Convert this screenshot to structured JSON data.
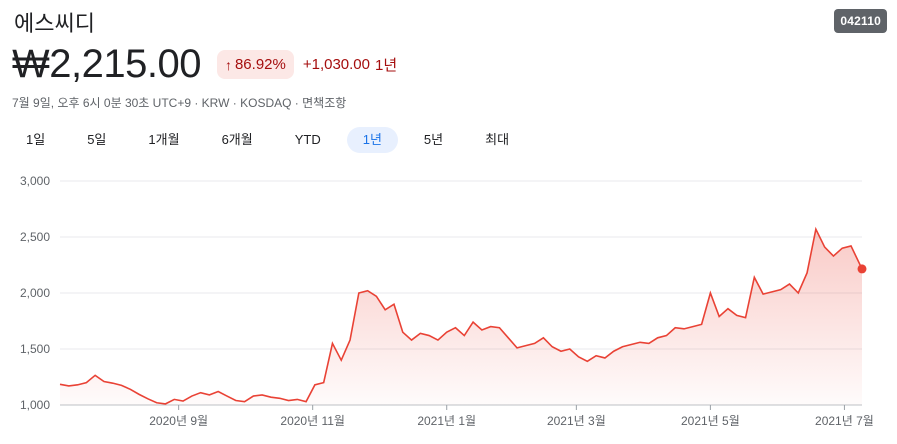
{
  "header": {
    "name": "에스씨디",
    "ticker": "042110",
    "price": "₩2,215.00",
    "change_pct": "86.92%",
    "change_abs": "+1,030.00",
    "change_period": "1년",
    "meta": "7월 9일, 오후 6시 0분 30초 UTC+9 · KRW · KOSDAQ · 면책조항"
  },
  "icons": {
    "change_arrow": "arrow-up-icon"
  },
  "colors": {
    "line": "#e94235",
    "negative_text": "#a50e0e",
    "active_tab": "#1a73e8"
  },
  "tabs": [
    {
      "label": "1일"
    },
    {
      "label": "5일"
    },
    {
      "label": "1개월"
    },
    {
      "label": "6개월"
    },
    {
      "label": "YTD"
    },
    {
      "label": "1년",
      "active": true
    },
    {
      "label": "5년"
    },
    {
      "label": "최대"
    }
  ],
  "chart_data": {
    "type": "area",
    "title": "",
    "xlabel": "",
    "ylabel": "",
    "ylim": [
      1000,
      3000
    ],
    "yticks": [
      1000,
      1500,
      2000,
      2500,
      3000
    ],
    "ytick_labels": [
      "1,000",
      "1,500",
      "2,000",
      "2,500",
      "3,000"
    ],
    "xticks": [
      {
        "label": "2020년 9월",
        "x": "2020-09-01"
      },
      {
        "label": "2020년 11월",
        "x": "2020-11-01"
      },
      {
        "label": "2021년 1월",
        "x": "2021-01-01"
      },
      {
        "label": "2021년 3월",
        "x": "2021-03-01"
      },
      {
        "label": "2021년 5월",
        "x": "2021-05-01"
      },
      {
        "label": "2021년 7월",
        "x": "2021-07-01"
      }
    ],
    "series": [
      {
        "x": [
          "2020-07-09",
          "2020-07-13",
          "2020-07-17",
          "2020-07-21",
          "2020-07-25",
          "2020-07-29",
          "2020-08-02",
          "2020-08-06",
          "2020-08-10",
          "2020-08-14",
          "2020-08-18",
          "2020-08-22",
          "2020-08-26",
          "2020-08-30",
          "2020-09-03",
          "2020-09-07",
          "2020-09-11",
          "2020-09-15",
          "2020-09-19",
          "2020-09-23",
          "2020-09-27",
          "2020-10-01",
          "2020-10-05",
          "2020-10-09",
          "2020-10-13",
          "2020-10-17",
          "2020-10-21",
          "2020-10-25",
          "2020-10-29",
          "2020-11-02",
          "2020-11-06",
          "2020-11-10",
          "2020-11-14",
          "2020-11-18",
          "2020-11-22",
          "2020-11-26",
          "2020-11-30",
          "2020-12-04",
          "2020-12-08",
          "2020-12-12",
          "2020-12-16",
          "2020-12-20",
          "2020-12-24",
          "2020-12-28",
          "2021-01-01",
          "2021-01-05",
          "2021-01-09",
          "2021-01-13",
          "2021-01-17",
          "2021-01-21",
          "2021-01-25",
          "2021-01-29",
          "2021-02-02",
          "2021-02-06",
          "2021-02-10",
          "2021-02-14",
          "2021-02-18",
          "2021-02-22",
          "2021-02-26",
          "2021-03-02",
          "2021-03-06",
          "2021-03-10",
          "2021-03-14",
          "2021-03-18",
          "2021-03-22",
          "2021-03-26",
          "2021-03-30",
          "2021-04-03",
          "2021-04-07",
          "2021-04-11",
          "2021-04-15",
          "2021-04-19",
          "2021-04-23",
          "2021-04-27",
          "2021-05-01",
          "2021-05-05",
          "2021-05-09",
          "2021-05-13",
          "2021-05-17",
          "2021-05-21",
          "2021-05-25",
          "2021-05-29",
          "2021-06-02",
          "2021-06-06",
          "2021-06-10",
          "2021-06-14",
          "2021-06-18",
          "2021-06-22",
          "2021-06-26",
          "2021-06-30",
          "2021-07-04",
          "2021-07-09"
        ],
        "values": [
          1185,
          1170,
          1180,
          1200,
          1265,
          1210,
          1195,
          1175,
          1140,
          1095,
          1055,
          1020,
          1010,
          1050,
          1035,
          1080,
          1110,
          1090,
          1120,
          1080,
          1040,
          1030,
          1080,
          1090,
          1070,
          1060,
          1040,
          1050,
          1030,
          1180,
          1200,
          1550,
          1400,
          1580,
          2000,
          2020,
          1970,
          1850,
          1900,
          1650,
          1580,
          1640,
          1620,
          1580,
          1650,
          1690,
          1620,
          1740,
          1670,
          1700,
          1690,
          1600,
          1510,
          1530,
          1550,
          1600,
          1520,
          1480,
          1500,
          1430,
          1390,
          1440,
          1420,
          1480,
          1520,
          1540,
          1560,
          1550,
          1600,
          1620,
          1690,
          1680,
          1700,
          1720,
          2000,
          1790,
          1860,
          1800,
          1780,
          2140,
          1990,
          2010,
          2030,
          2080,
          2000,
          2180,
          2570,
          2410,
          2330,
          2400,
          2420,
          2215
        ]
      }
    ]
  }
}
